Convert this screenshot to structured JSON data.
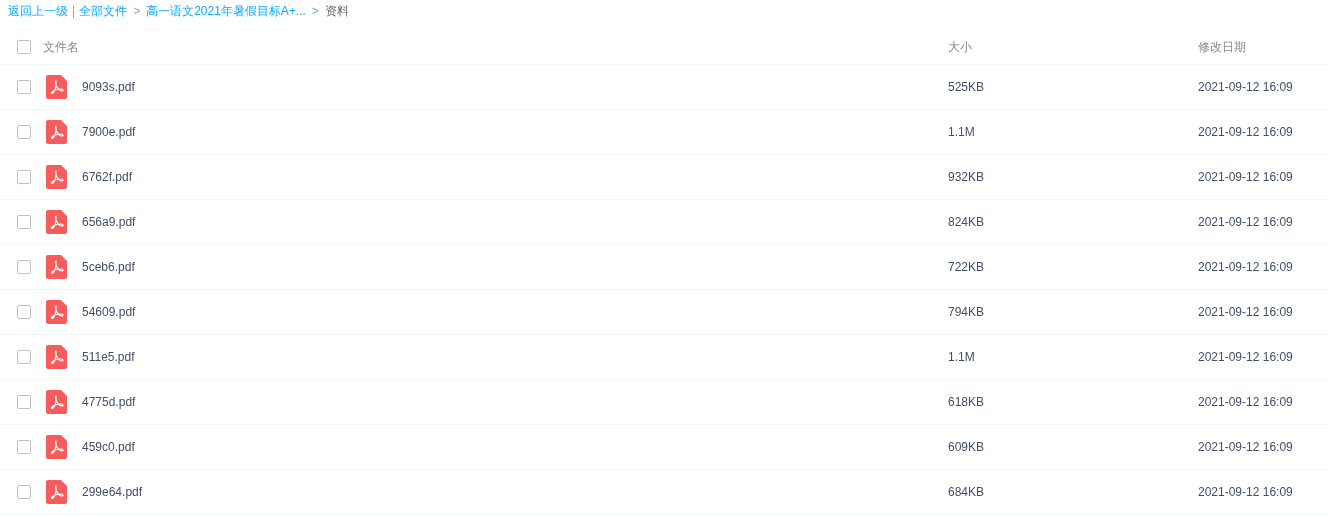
{
  "breadcrumb": [
    {
      "kind": "link",
      "text": "返回上一级"
    },
    {
      "kind": "divider",
      "text": "|"
    },
    {
      "kind": "link",
      "text": "全部文件"
    },
    {
      "kind": "separator",
      "text": ">"
    },
    {
      "kind": "link",
      "text": "高一语文2021年暑假目标A+..."
    },
    {
      "kind": "separator",
      "text": ">"
    },
    {
      "kind": "current",
      "text": "资料"
    }
  ],
  "table": {
    "select_all": {
      "checked": false
    },
    "columns": [
      "文件名",
      "大小",
      "修改日期"
    ],
    "rows": [
      {
        "name": "9093s.pdf",
        "size": "525KB",
        "modified": "2021-09-12 16:09",
        "selected": false
      },
      {
        "name": "7900e.pdf",
        "size": "1.1M",
        "modified": "2021-09-12 16:09",
        "selected": false
      },
      {
        "name": "6762f.pdf",
        "size": "932KB",
        "modified": "2021-09-12 16:09",
        "selected": false
      },
      {
        "name": "656a9.pdf",
        "size": "824KB",
        "modified": "2021-09-12 16:09",
        "selected": false
      },
      {
        "name": "5ceb6.pdf",
        "size": "722KB",
        "modified": "2021-09-12 16:09",
        "selected": false
      },
      {
        "name": "54609.pdf",
        "size": "794KB",
        "modified": "2021-09-12 16:09",
        "selected": false
      },
      {
        "name": "511e5.pdf",
        "size": "1.1M",
        "modified": "2021-09-12 16:09",
        "selected": false
      },
      {
        "name": "4775d.pdf",
        "size": "618KB",
        "modified": "2021-09-12 16:09",
        "selected": false
      },
      {
        "name": "459c0.pdf",
        "size": "609KB",
        "modified": "2021-09-12 16:09",
        "selected": false
      },
      {
        "name": "299e64.pdf",
        "size": "684KB",
        "modified": "2021-09-12 16:09",
        "selected": false
      }
    ]
  }
}
